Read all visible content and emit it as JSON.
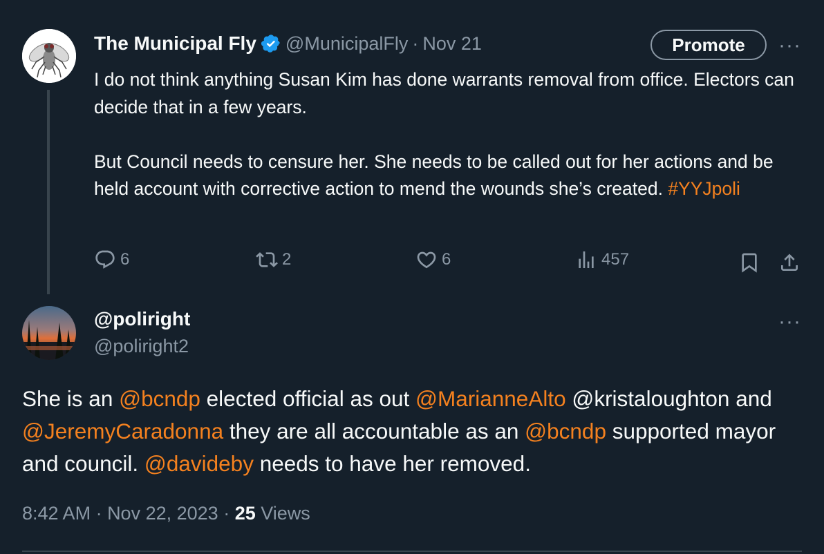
{
  "tweet1": {
    "author_name": "The Municipal Fly",
    "handle": "@MunicipalFly",
    "date": "Nov 21",
    "promote_label": "Promote",
    "more_label": "···",
    "body_line1": "I do not think anything Susan Kim has done warrants removal from office. Electors can decide that in a few years.",
    "body_line2_text": "But Council needs to censure her. She needs to be called out for her actions and be held account with corrective action to mend the wounds she’s created. ",
    "hashtag": "#YYJpoli",
    "actions": {
      "replies": "6",
      "reposts": "2",
      "likes": "6",
      "views": "457"
    }
  },
  "tweet2": {
    "author_name": "@poliright",
    "handle": "@poliright2",
    "more_label": "···",
    "body": {
      "t1": "She is an ",
      "m1": "@bcndp",
      "t2": " elected official as out ",
      "m2": "@MarianneAlto",
      "t3": " @kristaloughton and ",
      "m3": "@JeremyCaradonna",
      "t4": " they are all accountable as an ",
      "m4": "@bcndp",
      "t5": " supported mayor and council. ",
      "m5": "@davideby",
      "t6": " needs to have her removed."
    },
    "time": "8:42 AM",
    "date": "Nov 22, 2023",
    "views_count": "25",
    "views_label": "Views"
  },
  "colors": {
    "background": "#15202b",
    "text": "#f7f9f9",
    "secondary": "#8b98a5",
    "link": "#f4811f",
    "verified": "#1d9bf0"
  },
  "icons": [
    "fly-avatar",
    "verified-badge-icon",
    "reply-icon",
    "repost-icon",
    "like-icon",
    "views-icon",
    "bookmark-icon",
    "share-icon",
    "sunset-avatar"
  ]
}
